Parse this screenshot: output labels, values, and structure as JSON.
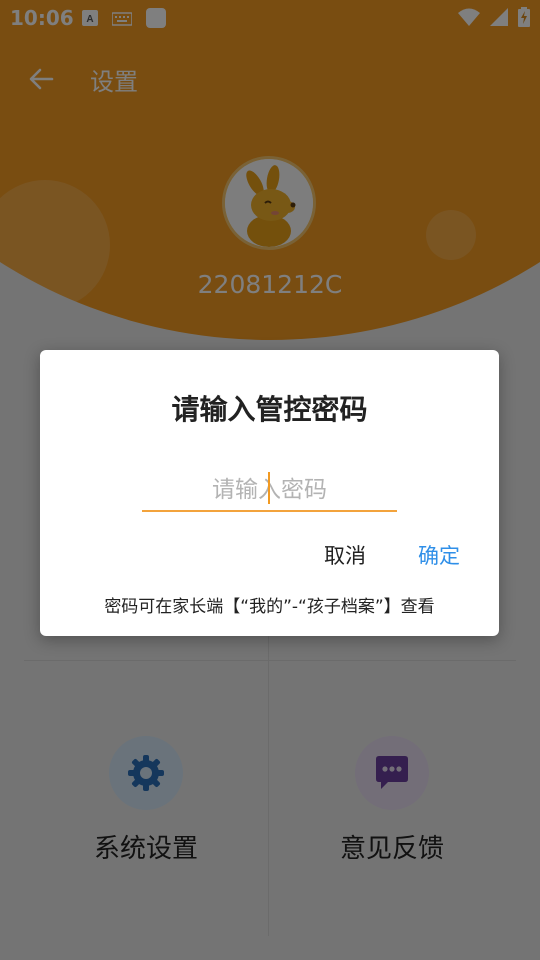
{
  "status_bar": {
    "time": "10:06",
    "icons_left": [
      "text-input-icon",
      "keyboard-icon",
      "app-square-icon"
    ],
    "icons_right": [
      "wifi-icon",
      "cell-signal-icon",
      "battery-charging-icon"
    ]
  },
  "appbar": {
    "back_icon": "arrow-left-icon",
    "title": "设置"
  },
  "profile": {
    "avatar_icon": "kangaroo-avatar-icon",
    "device_id": "22081212C"
  },
  "grid": {
    "items": [
      {
        "label": "系统设置",
        "icon": "gear-icon",
        "icon_color": "#2a6fb8"
      },
      {
        "label": "意见反馈",
        "icon": "chat-bubble-icon",
        "icon_color": "#6a3f9e"
      }
    ]
  },
  "dialog": {
    "title": "请输入管控密码",
    "input_placeholder": "请输入密码",
    "input_value": "",
    "cancel_label": "取消",
    "confirm_label": "确定",
    "hint": "密码可在家长端【“我的”-“孩子档案”】查看"
  },
  "colors": {
    "brand_orange": "#f29a22",
    "confirm_blue": "#2f8fe8",
    "underline": "#f3a33c"
  }
}
